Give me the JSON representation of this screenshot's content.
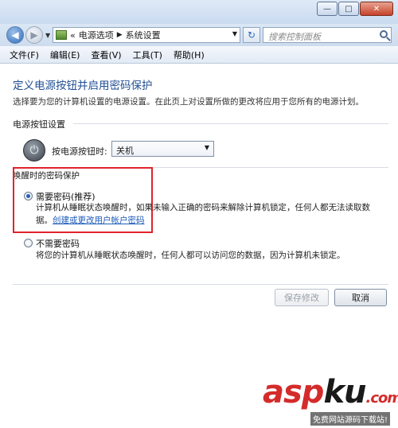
{
  "window": {
    "caption": {
      "minimize": "—",
      "maximize": "□",
      "close": "✕"
    }
  },
  "address": {
    "back_icon": "arrow-left-icon",
    "forward_icon": "arrow-right-icon",
    "prefix": "«",
    "breadcrumb": [
      "电源选项",
      "系统设置"
    ],
    "search_placeholder": "搜索控制面板"
  },
  "menu": [
    "文件(F)",
    "编辑(E)",
    "查看(V)",
    "工具(T)",
    "帮助(H)"
  ],
  "page": {
    "title": "定义电源按钮并启用密码保护",
    "description": "选择要为您的计算机设置的电源设置。在此页上对设置所做的更改将应用于您所有的电源计划。"
  },
  "power_section": {
    "heading": "电源按钮设置",
    "label": "按电源按钮时:",
    "selected": "关机"
  },
  "password_section": {
    "heading": "唤醒时的密码保护",
    "options": [
      {
        "label": "需要密码(推荐)",
        "checked": true,
        "desc_line1": "计算机从睡眠状态唤醒时，如果未输入正确的密码来解除计算机锁定，任何人都无法读取数",
        "desc_line2_prefix": "据。",
        "link": "创建或更改用户帐户密码"
      },
      {
        "label": "不需要密码",
        "checked": false,
        "desc_line1": "将您的计算机从睡眠状态唤醒时，任何人都可以访问您的数据，因为计算机未锁定。"
      }
    ]
  },
  "buttons": {
    "save": "保存修改",
    "cancel": "取消"
  },
  "watermark": {
    "brand_a": "asp",
    "brand_b": "ku",
    "suffix": ".com",
    "sub": "免费网站源码下载站!"
  },
  "colors": {
    "title": "#1f4e94",
    "link": "#1c5bb8",
    "highlight": "#e0242b"
  }
}
